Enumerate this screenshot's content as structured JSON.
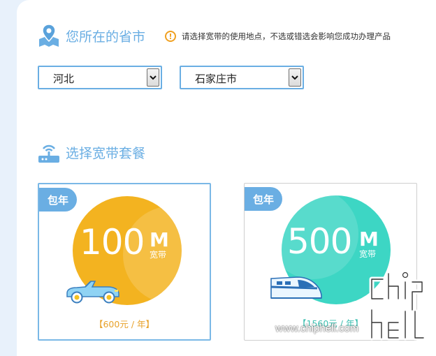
{
  "location": {
    "title": "您所在的省市",
    "hint": "请选择宽带的使用地点，不选或错选会影响您成功办理产品",
    "province": "河北",
    "city": "石家庄市"
  },
  "packages": {
    "title": "选择宽带套餐",
    "items": [
      {
        "tag": "包年",
        "speed": "100",
        "unit": "M",
        "unit_label": "宽带",
        "price": "【600元 / 年】",
        "color": "#f3b320"
      },
      {
        "tag": "包年",
        "speed": "500",
        "unit": "M",
        "unit_label": "宽带",
        "price": "【1560元 / 年】",
        "color": "#3dd6c4"
      }
    ]
  },
  "watermark": {
    "url": "www.chiphell.com",
    "logo_text": "chip hell"
  },
  "colors": {
    "accent": "#6aaee3",
    "warning": "#f0a020",
    "price_orange": "#e8a22b",
    "price_teal": "#3cbfb0"
  }
}
